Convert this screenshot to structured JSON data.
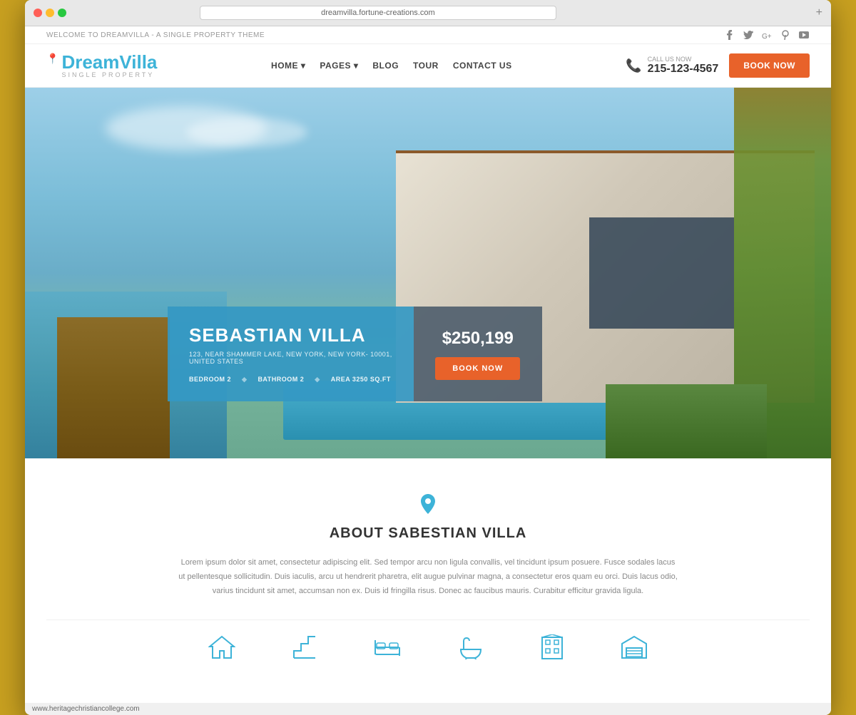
{
  "browser": {
    "url": "dreamvilla.fortune-creations.com",
    "close_btn": "×",
    "new_tab": "+"
  },
  "topbar": {
    "welcome_text": "WELCOME TO DREAMVILLA - A SINGLE PROPERTY THEME",
    "social_icons": [
      "facebook",
      "twitter",
      "google-plus",
      "pinterest",
      "youtube"
    ]
  },
  "nav": {
    "logo_name": "Dream",
    "logo_accent": "Villa",
    "logo_sub": "SINGLE PROPERTY",
    "logo_pin": "📍",
    "items": [
      {
        "label": "HOME",
        "has_dropdown": true
      },
      {
        "label": "PAGES",
        "has_dropdown": true
      },
      {
        "label": "BLOG"
      },
      {
        "label": "TOUR"
      },
      {
        "label": "CONTACT US"
      }
    ],
    "call_label": "CALL US NOW",
    "call_number": "215-123-4567",
    "book_btn": "BOOK NOW"
  },
  "hero": {
    "property_name": "SEBASTIAN VILLA",
    "property_address": "123, NEAR SHAMMER LAKE, NEW YORK, NEW YORK- 10001,",
    "property_address2": "UNITED STATES",
    "features": [
      {
        "label": "BEDROOM",
        "value": "2"
      },
      {
        "label": "BATHROOM",
        "value": "2"
      },
      {
        "label": "AREA",
        "value": "3250 SQ.FT"
      }
    ],
    "price": "$250,199",
    "book_btn": "BOOK NOW"
  },
  "about": {
    "pin_icon": "📍",
    "title": "ABOUT SABESTIAN VILLA",
    "body": "Lorem ipsum dolor sit amet, consectetur adipiscing elit. Sed tempor arcu non ligula convallis, vel tincidunt ipsum posuere. Fusce sodales lacus ut pellentesque sollicitudin. Duis iaculis, arcu ut hendrerit pharetra, elit augue pulvinar magna, a consectetur eros quam eu orci. Duis lacus odio, varius tincidunt sit amet, accumsan non ex. Duis id fringilla risus. Donec ac faucibus mauris. Curabitur efficitur gravida ligula.",
    "feature_icons": [
      {
        "name": "house-icon",
        "symbol": "⌂"
      },
      {
        "name": "stairs-icon",
        "symbol": "⌇"
      },
      {
        "name": "bed-icon",
        "symbol": "▭"
      },
      {
        "name": "bath-icon",
        "symbol": "♿"
      },
      {
        "name": "building-icon",
        "symbol": "▣"
      },
      {
        "name": "garage-icon",
        "symbol": "⌂"
      }
    ]
  },
  "statusbar": {
    "url": "www.heritagechristiancollege.com"
  }
}
